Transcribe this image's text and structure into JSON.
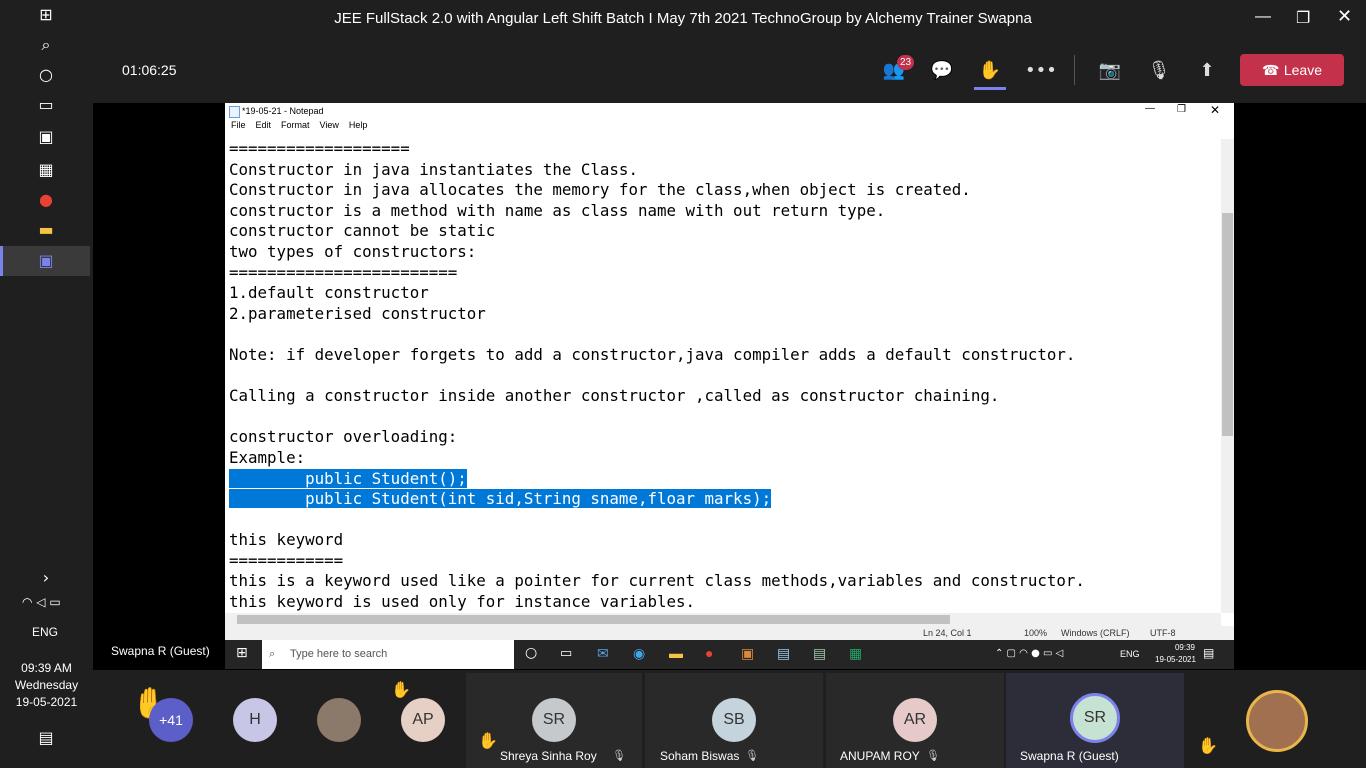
{
  "meeting": {
    "title": "JEE FullStack 2.0 with Angular Left Shift Batch I May 7th 2021 TechnoGroup by Alchemy Trainer Swapna",
    "elapsed": "01:06:25",
    "participants_badge": "23",
    "leave_label": "Leave",
    "presenter_label": "Swapna R (Guest)"
  },
  "notepad": {
    "window_title": "*19-05-21 - Notepad",
    "menu": [
      "File",
      "Edit",
      "Format",
      "View",
      "Help"
    ],
    "lines": [
      "===================",
      "Constructor in java instantiates the Class.",
      "Constructor in java allocates the memory for the class,when object is created.",
      "constructor is a method with name as class name with out return type.",
      "constructor cannot be static",
      "two types of constructors:",
      "========================",
      "1.default constructor",
      "2.parameterised constructor",
      "",
      "Note: if developer forgets to add a constructor,java compiler adds a default constructor.",
      "",
      "Calling a constructor inside another constructor ,called as constructor chaining.",
      "",
      "constructor overloading:",
      "Example:",
      "        public Student();",
      "        public Student(int sid,String sname,floar marks);",
      "",
      "this keyword",
      "============",
      "this is a keyword used like a pointer for current class methods,variables and constructor.",
      "this keyword is used only for instance variables."
    ],
    "selected_lines": [
      16,
      17
    ],
    "status": {
      "position": "Ln 24, Col 1",
      "zoom": "100%",
      "line_ending": "Windows (CRLF)",
      "encoding": "UTF-8"
    }
  },
  "inner_taskbar": {
    "search_placeholder": "Type here to search",
    "lang": "ENG",
    "time": "09:39",
    "date": "19-05-2021"
  },
  "system_clock": {
    "lang": "ENG",
    "time": "09:39 AM",
    "day": "Wednesday",
    "date": "19-05-2021"
  },
  "participants": {
    "overflow": "+41",
    "avatars": [
      {
        "initials": "H",
        "color": "#c8c6e6"
      },
      {
        "initials": "",
        "color": "#8b7a6a"
      },
      {
        "initials": "AP",
        "color": "#e6d0c6"
      }
    ],
    "tiles": [
      {
        "initials": "SR",
        "name": "Shreya Sinha Roy",
        "color": "#c5c9cc"
      },
      {
        "initials": "SB",
        "name": "Soham Biswas",
        "color": "#c5d4dc"
      },
      {
        "initials": "AR",
        "name": "ANUPAM ROY",
        "color": "#e6c9c9"
      },
      {
        "initials": "SR",
        "name": "Swapna R (Guest)",
        "color": "#c6e2d3"
      }
    ]
  },
  "colors": {
    "leave": "#c4314b",
    "selection": "#0078d7",
    "teams_accent": "#7b83eb"
  }
}
